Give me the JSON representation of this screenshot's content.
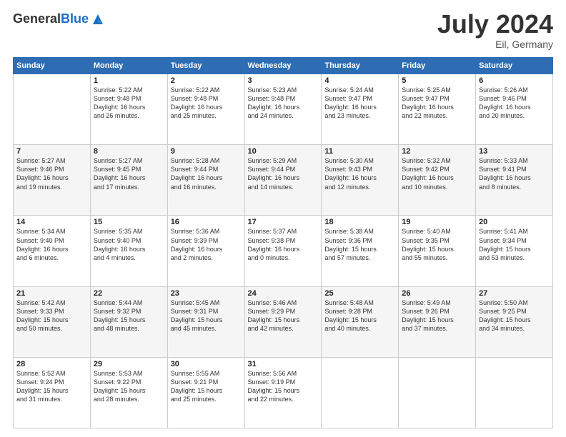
{
  "header": {
    "logo_general": "General",
    "logo_blue": "Blue",
    "month_year": "July 2024",
    "location": "Eil, Germany"
  },
  "days_of_week": [
    "Sunday",
    "Monday",
    "Tuesday",
    "Wednesday",
    "Thursday",
    "Friday",
    "Saturday"
  ],
  "weeks": [
    [
      {
        "day": "",
        "info": ""
      },
      {
        "day": "1",
        "info": "Sunrise: 5:22 AM\nSunset: 9:48 PM\nDaylight: 16 hours\nand 26 minutes."
      },
      {
        "day": "2",
        "info": "Sunrise: 5:22 AM\nSunset: 9:48 PM\nDaylight: 16 hours\nand 25 minutes."
      },
      {
        "day": "3",
        "info": "Sunrise: 5:23 AM\nSunset: 9:48 PM\nDaylight: 16 hours\nand 24 minutes."
      },
      {
        "day": "4",
        "info": "Sunrise: 5:24 AM\nSunset: 9:47 PM\nDaylight: 16 hours\nand 23 minutes."
      },
      {
        "day": "5",
        "info": "Sunrise: 5:25 AM\nSunset: 9:47 PM\nDaylight: 16 hours\nand 22 minutes."
      },
      {
        "day": "6",
        "info": "Sunrise: 5:26 AM\nSunset: 9:46 PM\nDaylight: 16 hours\nand 20 minutes."
      }
    ],
    [
      {
        "day": "7",
        "info": "Sunrise: 5:27 AM\nSunset: 9:46 PM\nDaylight: 16 hours\nand 19 minutes."
      },
      {
        "day": "8",
        "info": "Sunrise: 5:27 AM\nSunset: 9:45 PM\nDaylight: 16 hours\nand 17 minutes."
      },
      {
        "day": "9",
        "info": "Sunrise: 5:28 AM\nSunset: 9:44 PM\nDaylight: 16 hours\nand 16 minutes."
      },
      {
        "day": "10",
        "info": "Sunrise: 5:29 AM\nSunset: 9:44 PM\nDaylight: 16 hours\nand 14 minutes."
      },
      {
        "day": "11",
        "info": "Sunrise: 5:30 AM\nSunset: 9:43 PM\nDaylight: 16 hours\nand 12 minutes."
      },
      {
        "day": "12",
        "info": "Sunrise: 5:32 AM\nSunset: 9:42 PM\nDaylight: 16 hours\nand 10 minutes."
      },
      {
        "day": "13",
        "info": "Sunrise: 5:33 AM\nSunset: 9:41 PM\nDaylight: 16 hours\nand 8 minutes."
      }
    ],
    [
      {
        "day": "14",
        "info": "Sunrise: 5:34 AM\nSunset: 9:40 PM\nDaylight: 16 hours\nand 6 minutes."
      },
      {
        "day": "15",
        "info": "Sunrise: 5:35 AM\nSunset: 9:40 PM\nDaylight: 16 hours\nand 4 minutes."
      },
      {
        "day": "16",
        "info": "Sunrise: 5:36 AM\nSunset: 9:39 PM\nDaylight: 16 hours\nand 2 minutes."
      },
      {
        "day": "17",
        "info": "Sunrise: 5:37 AM\nSunset: 9:38 PM\nDaylight: 16 hours\nand 0 minutes."
      },
      {
        "day": "18",
        "info": "Sunrise: 5:38 AM\nSunset: 9:36 PM\nDaylight: 15 hours\nand 57 minutes."
      },
      {
        "day": "19",
        "info": "Sunrise: 5:40 AM\nSunset: 9:35 PM\nDaylight: 15 hours\nand 55 minutes."
      },
      {
        "day": "20",
        "info": "Sunrise: 5:41 AM\nSunset: 9:34 PM\nDaylight: 15 hours\nand 53 minutes."
      }
    ],
    [
      {
        "day": "21",
        "info": "Sunrise: 5:42 AM\nSunset: 9:33 PM\nDaylight: 15 hours\nand 50 minutes."
      },
      {
        "day": "22",
        "info": "Sunrise: 5:44 AM\nSunset: 9:32 PM\nDaylight: 15 hours\nand 48 minutes."
      },
      {
        "day": "23",
        "info": "Sunrise: 5:45 AM\nSunset: 9:31 PM\nDaylight: 15 hours\nand 45 minutes."
      },
      {
        "day": "24",
        "info": "Sunrise: 5:46 AM\nSunset: 9:29 PM\nDaylight: 15 hours\nand 42 minutes."
      },
      {
        "day": "25",
        "info": "Sunrise: 5:48 AM\nSunset: 9:28 PM\nDaylight: 15 hours\nand 40 minutes."
      },
      {
        "day": "26",
        "info": "Sunrise: 5:49 AM\nSunset: 9:26 PM\nDaylight: 15 hours\nand 37 minutes."
      },
      {
        "day": "27",
        "info": "Sunrise: 5:50 AM\nSunset: 9:25 PM\nDaylight: 15 hours\nand 34 minutes."
      }
    ],
    [
      {
        "day": "28",
        "info": "Sunrise: 5:52 AM\nSunset: 9:24 PM\nDaylight: 15 hours\nand 31 minutes."
      },
      {
        "day": "29",
        "info": "Sunrise: 5:53 AM\nSunset: 9:22 PM\nDaylight: 15 hours\nand 28 minutes."
      },
      {
        "day": "30",
        "info": "Sunrise: 5:55 AM\nSunset: 9:21 PM\nDaylight: 15 hours\nand 25 minutes."
      },
      {
        "day": "31",
        "info": "Sunrise: 5:56 AM\nSunset: 9:19 PM\nDaylight: 15 hours\nand 22 minutes."
      },
      {
        "day": "",
        "info": ""
      },
      {
        "day": "",
        "info": ""
      },
      {
        "day": "",
        "info": ""
      }
    ]
  ]
}
